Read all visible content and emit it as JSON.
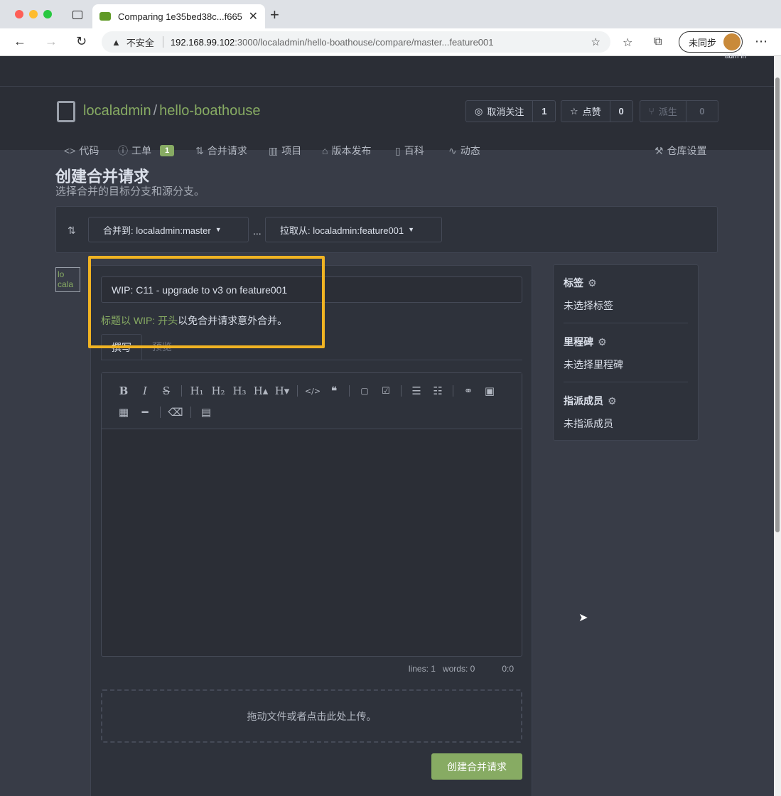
{
  "browser": {
    "tab_title": "Comparing 1e35bed38c...f665",
    "address_warning": "不安全",
    "address_host": "192.168.99.102",
    "address_path": ":3000/localadmin/hello-boathouse/compare/master...feature001",
    "sync_label": "未同步",
    "avatar_label": "adm\nin"
  },
  "repo": {
    "owner": "localadmin",
    "name": "hello-boathouse",
    "watch_label": "取消关注",
    "watch_count": "1",
    "star_label": "点赞",
    "star_count": "0",
    "fork_label": "派生",
    "fork_count": "0"
  },
  "menu": {
    "code": "代码",
    "issues": "工单",
    "issues_count": "1",
    "pulls": "合并请求",
    "projects": "项目",
    "releases": "版本发布",
    "wiki": "百科",
    "activity": "动态",
    "settings": "仓库设置"
  },
  "page": {
    "title": "创建合并请求",
    "subtitle": "选择合并的目标分支和源分支。",
    "base_select": "合并到: localadmin:master",
    "dots": "...",
    "head_select": "拉取从: localadmin:feature001",
    "avatar_alt": "lo cala"
  },
  "form": {
    "title_value": "WIP: C11 - upgrade to v3 on feature001",
    "hint_green": "标题以 WIP: 开头",
    "hint_rest": "以免合并请求意外合并。",
    "tab_write": "撰写",
    "tab_preview": "预览",
    "status_lines": "lines: 1",
    "status_words": "words: 0",
    "status_cursor": "0:0",
    "upload_text": "拖动文件或者点击此处上传。",
    "submit_label": "创建合并请求"
  },
  "sidebar": {
    "labels_title": "标签",
    "labels_value": "未选择标签",
    "milestone_title": "里程碑",
    "milestone_value": "未选择里程碑",
    "assignees_title": "指派成员",
    "assignees_value": "未指派成员"
  },
  "colors": {
    "accent": "#87ab63",
    "highlight": "#f0b323",
    "background": "#383c47"
  }
}
